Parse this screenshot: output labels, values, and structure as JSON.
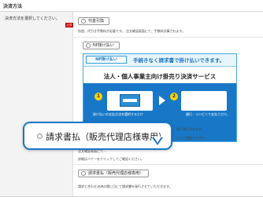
{
  "section": {
    "title": "決済方法"
  },
  "form": {
    "instruction": "決済方法を選択してください。",
    "required_badge": "必須"
  },
  "options": [
    {
      "label": "代金引換",
      "note": "別途、代引き手数料が必要です。 注文確認画面にて、手数料計算されます。"
    },
    {
      "label": "NP掛け払い"
    },
    {
      "label": "請求書払（販売代理店様専用）",
      "note": "請求と合わせ決済の際に日にて請求書を発行させていただきます。"
    }
  ],
  "np_banner": {
    "logo_text": "NP掛け払い",
    "tagline": "手続きなく請求書で掛け払いできます。",
    "headline": "法人・個人事業主向け掛売り決済サービス",
    "step1": "1",
    "step2": "2",
    "step1_caption": "掛け払いの支払方法を選択するだけ",
    "step2_caption": "銀行・コンビニで支払うだけ。"
  },
  "partial_notes": {
    "right_1": "案に発行されます。",
    "right_2": "にてご確認ください。",
    "left_1": "注文確認画面にて...",
    "left_2": "詳細はバナーをクリックしてご確認ください。"
  },
  "callout": {
    "label": "請求書払（販売代理店様専用）"
  },
  "colors": {
    "accent_blue": "#1878c7",
    "np_logo_blue": "#1877c5",
    "required_red": "#c00000",
    "step_yellow": "#ffd400"
  }
}
